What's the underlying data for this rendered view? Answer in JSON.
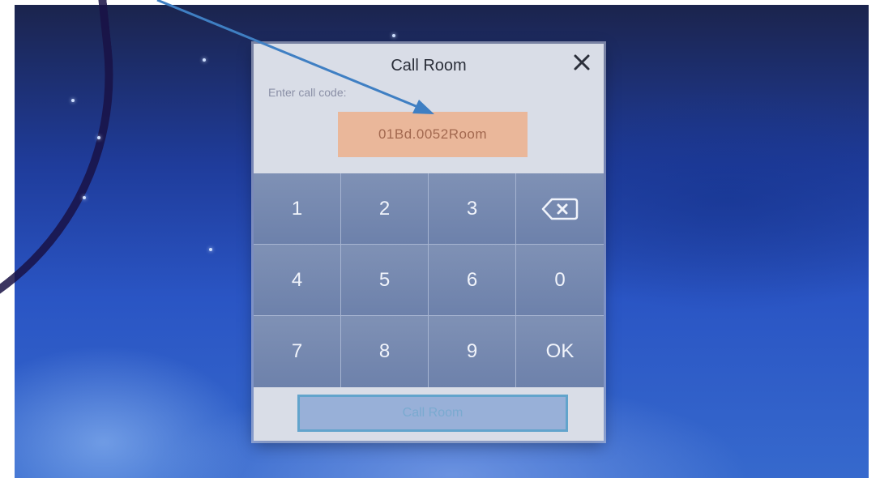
{
  "dialog": {
    "title": "Call Room",
    "prompt": "Enter call code:",
    "code_value": "01Bd.0052Room",
    "close_icon": "close-icon",
    "call_button_label": "Call Room"
  },
  "keypad": {
    "keys": [
      "1",
      "2",
      "3",
      "backspace",
      "4",
      "5",
      "6",
      "0",
      "7",
      "8",
      "9",
      "OK"
    ],
    "backspace_icon": "backspace-icon"
  },
  "colors": {
    "code_highlight": "#eab79a",
    "annotation_arrow": "#3f7fc3",
    "keypad_bg": "#7d8fb3"
  }
}
